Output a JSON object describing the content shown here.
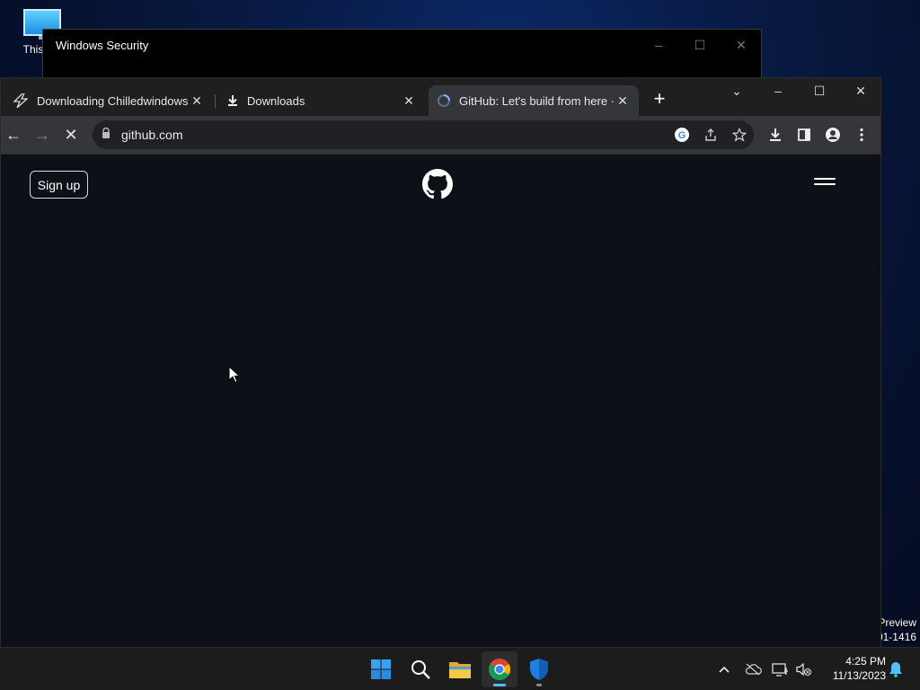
{
  "desktop": {
    "icon_label": "This PC",
    "watermark_line1": "Preview",
    "watermark_line2": "01-1416"
  },
  "security_window": {
    "title": "Windows Security",
    "minimize": "–",
    "maximize": "☐",
    "close": "✕"
  },
  "browser": {
    "tabs": [
      {
        "title": "Downloading Chilledwindows.exe",
        "close": "✕",
        "icon": "lightning-icon"
      },
      {
        "title": "Downloads",
        "close": "✕",
        "icon": "download-icon"
      },
      {
        "title": "GitHub: Let's build from here · GitHub",
        "close": "✕",
        "icon": "loading-spinner-icon"
      }
    ],
    "new_tab": "+",
    "tab_search": "⌄",
    "minimize": "–",
    "maximize": "☐",
    "close": "✕",
    "url": "github.com",
    "nav": {
      "back": "←",
      "forward": "→",
      "stop": "✕"
    }
  },
  "page": {
    "signup_label": "Sign up"
  },
  "taskbar": {
    "time": "4:25 PM",
    "date": "11/13/2023",
    "tray_chevron": "^"
  },
  "colors": {
    "github_bg": "#0d1117",
    "chrome_toolbar": "#35363a",
    "tabstrip": "#1f1f1f",
    "taskbar": "#1c1c1c",
    "accent": "#4cc2ff"
  }
}
